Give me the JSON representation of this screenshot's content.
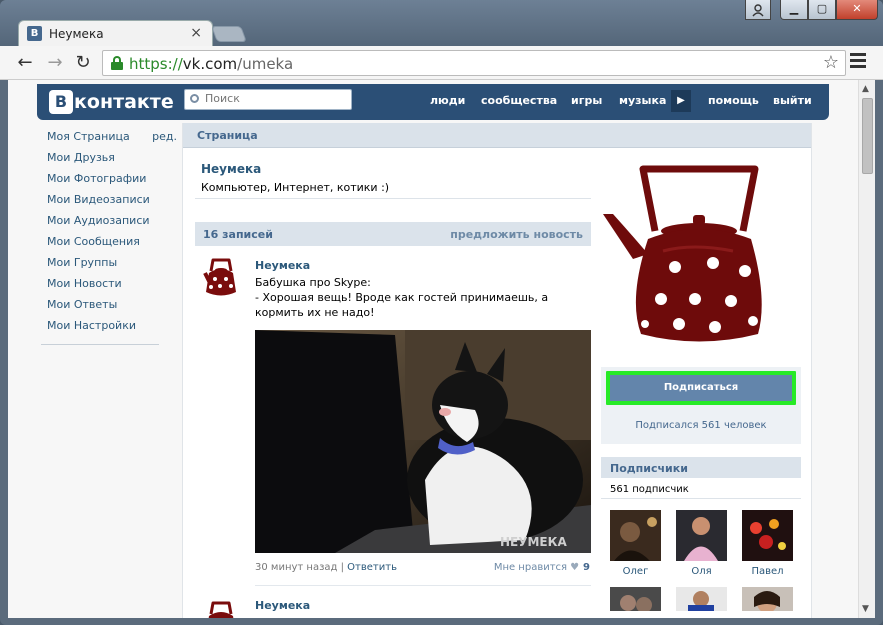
{
  "browser": {
    "tab_title": "Неумека",
    "tab_favicon": "В",
    "url_scheme": "https://",
    "url_host": "vk.com",
    "url_path": "/umeka",
    "icons": [
      "back-arrow-icon",
      "forward-arrow-icon",
      "reload-icon",
      "lock-icon",
      "star-icon",
      "menu-icon",
      "close-icon",
      "user-icon",
      "minimize-icon",
      "maximize-icon"
    ]
  },
  "vk": {
    "logo_letter": "В",
    "logo_text": "контакте",
    "search_placeholder": "Поиск",
    "nav": [
      "люди",
      "сообщества",
      "игры",
      "музыка",
      "помощь",
      "выйти"
    ],
    "brand_color": "#2b4f76"
  },
  "left_menu": {
    "items": [
      "Моя Страница",
      "Мои Друзья",
      "Мои Фотографии",
      "Мои Видеозаписи",
      "Мои Аудиозаписи",
      "Мои Сообщения",
      "Мои Группы",
      "Мои Новости",
      "Мои Ответы",
      "Мои Настройки"
    ],
    "edit_label": "ред."
  },
  "page": {
    "header": "Страница",
    "name": "Неумека",
    "status": "Компьютер, Интернет, котики :)"
  },
  "wall": {
    "count_label": "16 записей",
    "suggest_label": "предложить новость",
    "posts": [
      {
        "author": "Неумека",
        "text_line1": "Бабушка про Skype:",
        "text_line2": "- Хорошая вещь! Вроде как гостей принимаешь, а кормить их не надо!",
        "watermark": "НЕУМЕКА",
        "time": "30 минут назад",
        "reply": "Ответить",
        "like_label": "Мне нравится",
        "likes": "9"
      },
      {
        "author": "Неумека"
      }
    ]
  },
  "sidebar": {
    "subscribe_label": "Подписаться",
    "subscribed_count": "Подписался 561 человек",
    "subscribers_title": "Подписчики",
    "subscribers_count": "561 подписчик",
    "subscribers": [
      {
        "name": "Олег",
        "color": "#3a2a1e"
      },
      {
        "name": "Оля",
        "color": "#d8b2c8"
      },
      {
        "name": "Павел",
        "color": "#2a1410"
      }
    ],
    "highlight_color": "#27ea27"
  }
}
